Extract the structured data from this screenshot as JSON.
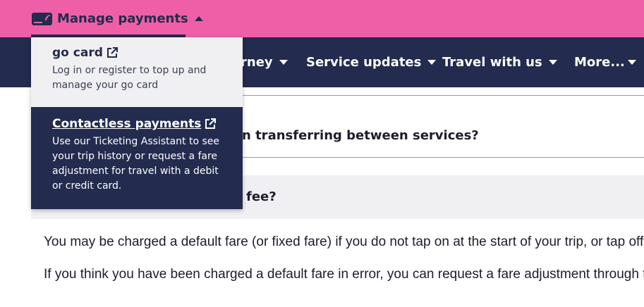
{
  "topbar": {
    "manage_label": "Manage payments",
    "card_icon": "card-reader-icon",
    "accent_color": "#ef5fa7"
  },
  "nav": {
    "items": [
      {
        "label": "rney"
      },
      {
        "label": "Service updates"
      },
      {
        "label": "Travel with us"
      },
      {
        "label": "More..."
      }
    ],
    "background": "#232b4e"
  },
  "dropdown": {
    "go_card": {
      "title": "go card",
      "description": "Log in or register to top up and manage your go card",
      "icon": "external-link-icon"
    },
    "contactless": {
      "title": "Contactless payments",
      "description": "Use our Ticketing Assistant to see your trip history or request a fare adjustment for travel with a debit or credit card.",
      "icon": "external-link-icon"
    }
  },
  "content": {
    "question_1_fragment": "n transferring between services?",
    "question_2_fragment": "fee?",
    "paragraph_1": "You may be charged a default fare (or fixed fare) if you do not tap on at the start of your trip, or tap off at",
    "paragraph_2": "If you think you have been charged a default fare in error, you can request a fare adjustment through the"
  }
}
